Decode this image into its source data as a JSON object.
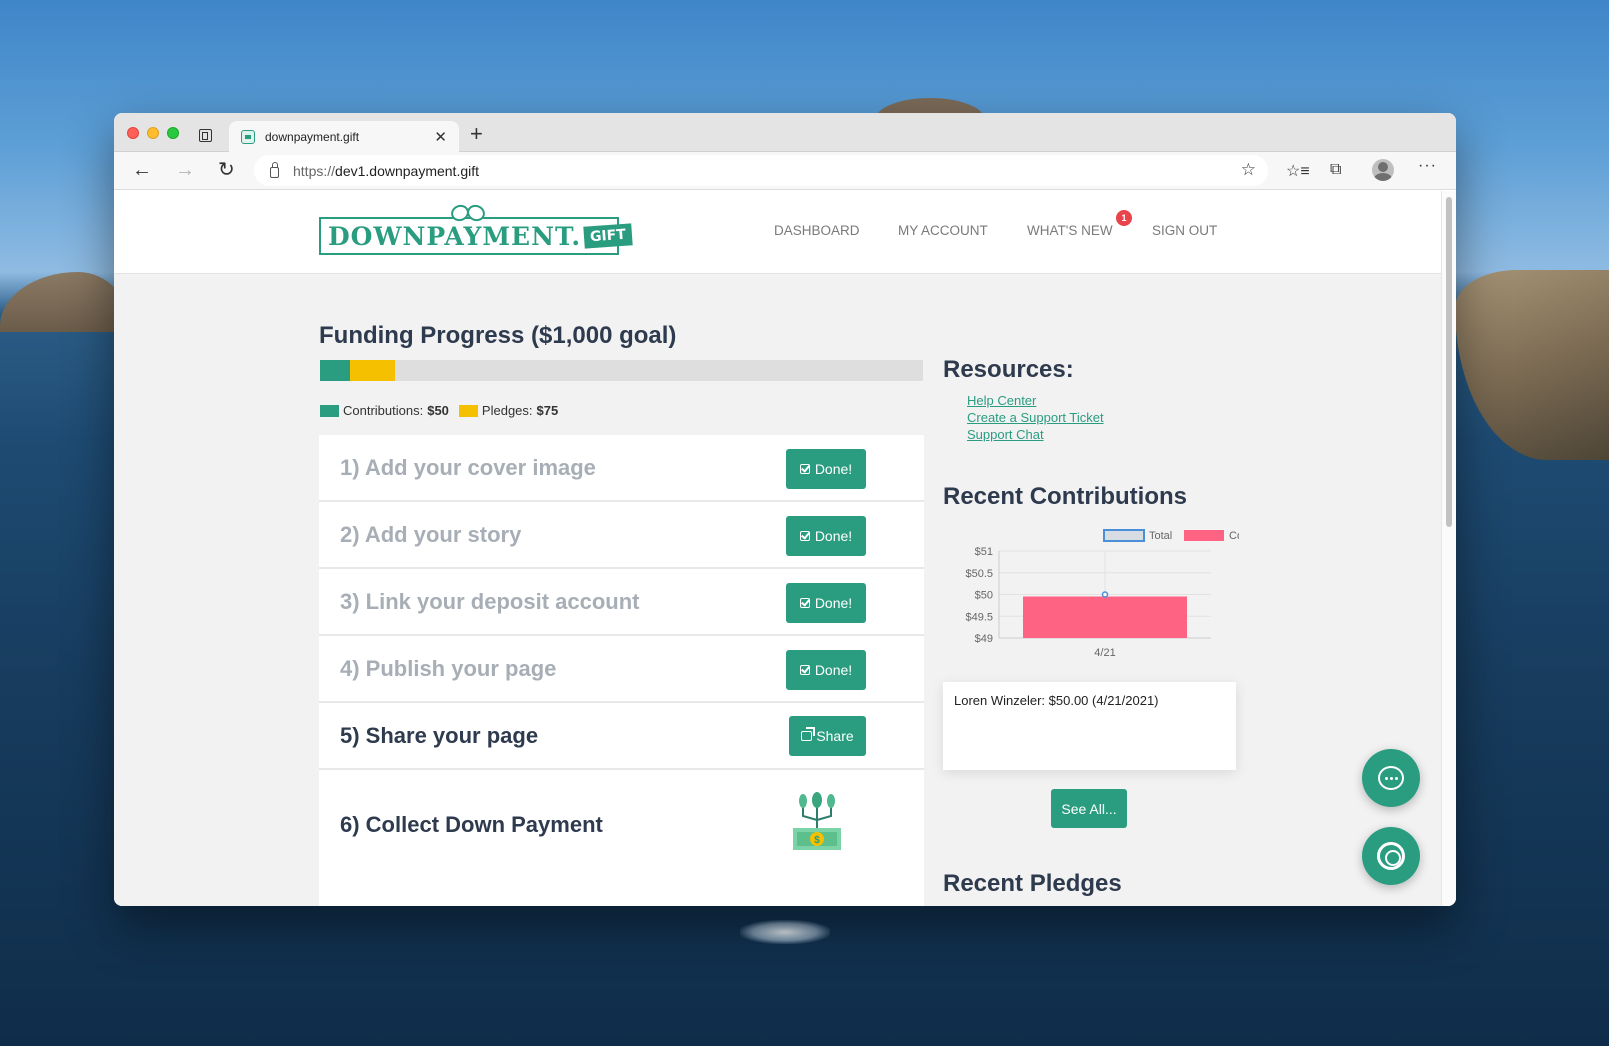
{
  "browser": {
    "tab_title": "downpayment.gift",
    "url_scheme": "https://",
    "url_host": "dev1.downpayment.gift"
  },
  "site": {
    "logo_text": "DOWNPAYMENT.",
    "logo_badge": "GIFT",
    "nav": {
      "dashboard": "DASHBOARD",
      "my_account": "MY ACCOUNT",
      "whats_new": "WHAT'S NEW",
      "whats_new_badge": "1",
      "sign_out": "SIGN OUT"
    }
  },
  "funding": {
    "title": "Funding Progress ($1,000 goal)",
    "goal": 1000,
    "contributions_amount": 50,
    "pledges_amount": 75,
    "contributions_label": "Contributions:",
    "contributions_value": "$50",
    "pledges_label": "Pledges:",
    "pledges_value": "$75",
    "colors": {
      "contributions": "#2a9d80",
      "pledges": "#f5c000"
    }
  },
  "steps": [
    {
      "label": "1) Add your cover image",
      "button": "Done!",
      "state": "done"
    },
    {
      "label": "2) Add your story",
      "button": "Done!",
      "state": "done"
    },
    {
      "label": "3) Link your deposit account",
      "button": "Done!",
      "state": "done"
    },
    {
      "label": "4) Publish your page",
      "button": "Done!",
      "state": "done"
    },
    {
      "label": "5) Share your page",
      "button": "Share",
      "state": "active"
    },
    {
      "label": "6) Collect Down Payment",
      "icon": "money-tree-icon",
      "state": "active"
    }
  ],
  "resources": {
    "title": "Resources:",
    "links": [
      "Help Center",
      "Create a Support Ticket",
      "Support Chat"
    ]
  },
  "recent_contributions": {
    "title": "Recent Contributions",
    "entry": "Loren Winzeler: $50.00 (4/21/2021)",
    "see_all": "See All..."
  },
  "recent_pledges": {
    "title": "Recent Pledges"
  },
  "chart_data": {
    "type": "bar",
    "categories": [
      "4/21"
    ],
    "series": [
      {
        "name": "Total",
        "type": "line",
        "values": [
          50
        ],
        "color": "#4a90d9"
      },
      {
        "name": "Contribution",
        "type": "bar",
        "values": [
          50
        ],
        "color": "#ff6384"
      }
    ],
    "y_ticks": [
      "$51",
      "$50.5",
      "$50",
      "$49.5",
      "$49"
    ],
    "ylim": [
      49,
      51
    ],
    "legend_position": "top",
    "grid": true
  }
}
